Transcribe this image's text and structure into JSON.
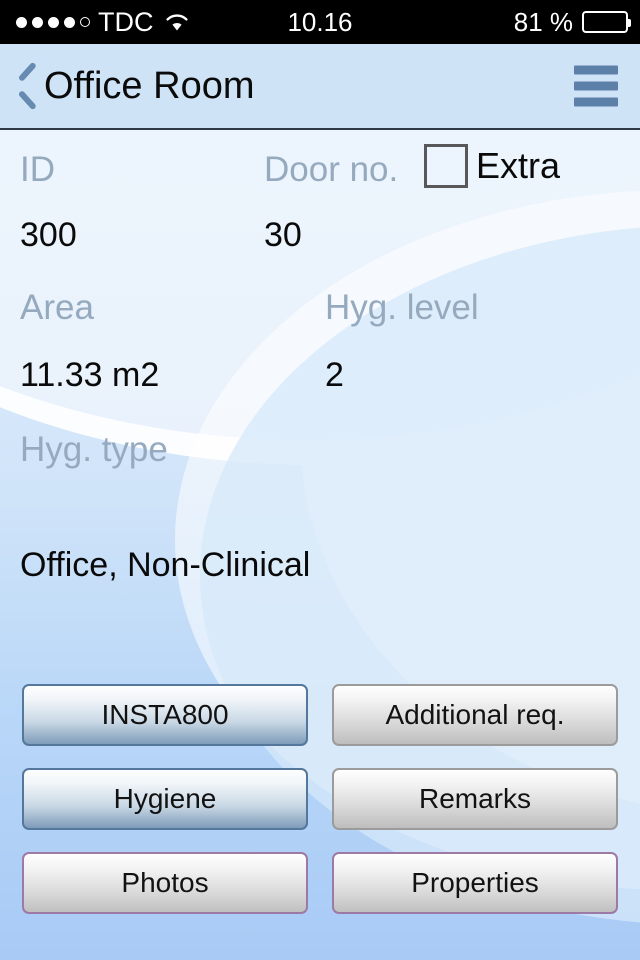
{
  "status_bar": {
    "signal_dots_filled": 4,
    "signal_dots_total": 5,
    "carrier": "TDC",
    "wifi_icon": "wifi-icon",
    "time": "10.16",
    "battery_percent": "81 %",
    "battery_level": 81
  },
  "nav": {
    "back_icon": "chevron-left-icon",
    "title": "Office Room",
    "menu_icon": "hamburger-menu-icon"
  },
  "form": {
    "id": {
      "label": "ID",
      "value": "300"
    },
    "door_no": {
      "label": "Door no.",
      "value": "30"
    },
    "extra": {
      "label": "Extra",
      "checked": false
    },
    "area": {
      "label": "Area",
      "value": "11.33  m2"
    },
    "hyg_level": {
      "label": "Hyg. level",
      "value": "2"
    },
    "hyg_type": {
      "label": "Hyg. type",
      "value": "Office, Non-Clinical"
    }
  },
  "buttons": [
    {
      "label": "INSTA800",
      "style": "blue"
    },
    {
      "label": "Additional req.",
      "style": "gray"
    },
    {
      "label": "Hygiene",
      "style": "blue"
    },
    {
      "label": "Remarks",
      "style": "gray"
    },
    {
      "label": "Photos",
      "style": "purple"
    },
    {
      "label": "Properties",
      "style": "purple"
    }
  ],
  "colors": {
    "nav_bar_bg": "#cfe3f7",
    "accent_blue": "#5d80a9",
    "label_text": "#95aabe",
    "value_text": "#0a0a0a",
    "page_bg_top": "#e8f1fb",
    "page_bg_bottom": "#a8caf5",
    "button_blue_border": "#53789b",
    "button_gray_border": "#9b9b9b",
    "button_purple_border": "#9d79a6"
  }
}
